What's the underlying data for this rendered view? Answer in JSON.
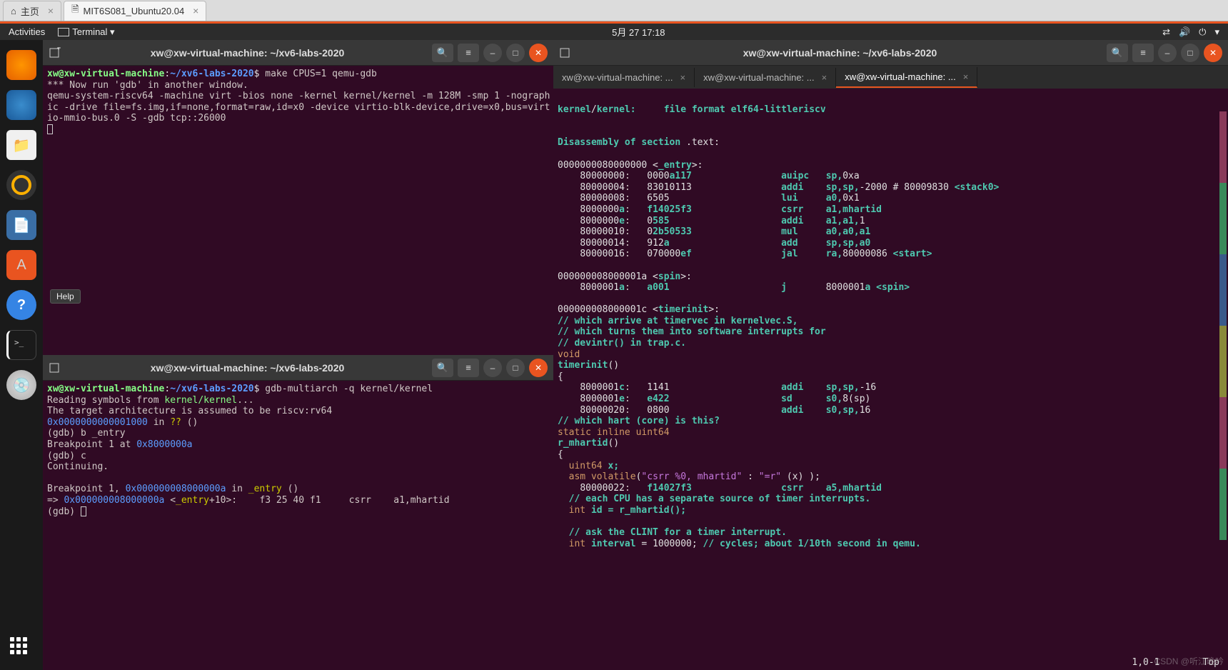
{
  "browserTabs": {
    "home": "主页",
    "vm": "MIT6S081_Ubuntu20.04"
  },
  "topbar": {
    "activities": "Activities",
    "terminal": "Terminal ▾",
    "clock": "5月 27  17:18"
  },
  "tooltip": "Help",
  "term1": {
    "title": "xw@xw-virtual-machine: ~/xv6-labs-2020",
    "prompt_user": "xw@xw-virtual-machine",
    "prompt_path": "~/xv6-labs-2020",
    "cmd": "make CPUS=1 qemu-gdb",
    "l1": "*** Now run 'gdb' in another window.",
    "l2": "qemu-system-riscv64 -machine virt -bios none -kernel kernel/kernel -m 128M -smp 1 -nograph",
    "l3": "ic -drive file=fs.img,if=none,format=raw,id=x0 -device virtio-blk-device,drive=x0,bus=virt",
    "l4": "io-mmio-bus.0 -S -gdb tcp::26000"
  },
  "term2": {
    "title": "xw@xw-virtual-machine: ~/xv6-labs-2020",
    "cmd": "gdb-multiarch -q kernel/kernel",
    "r1_a": "Reading symbols from ",
    "r1_b": "kernel/kernel",
    "r1_c": "...",
    "r2": "The target architecture is assumed to be riscv:rv64",
    "r3_a": "0x0000000000001000",
    "r3_b": " in ",
    "r3_c": "??",
    "r3_d": " ()",
    "r4": "(gdb) b _entry",
    "r5_a": "Breakpoint 1 at ",
    "r5_b": "0x8000000a",
    "r6": "(gdb) c",
    "r7": "Continuing.",
    "r8": "",
    "r9_a": "Breakpoint 1, ",
    "r9_b": "0x000000008000000a",
    "r9_c": " in ",
    "r9_d": "_entry",
    "r9_e": " ()",
    "r10_a": "=> ",
    "r10_b": "0x000000008000000a",
    "r10_c": " <",
    "r10_d": "_entry",
    "r10_e": "+10>:    f3 25 40 f1     csrr    a1,mhartid",
    "r11": "(gdb) "
  },
  "term3": {
    "title": "xw@xw-virtual-machine: ~/xv6-labs-2020",
    "tabs": [
      "xw@xw-virtual-machine: ...",
      "xw@xw-virtual-machine: ...",
      "xw@xw-virtual-machine: ..."
    ],
    "status_pos": "1,0-1",
    "status_right": "Top",
    "h1_a": "kernel",
    "h1_b": "/",
    "h1_c": "kernel:",
    "h1_d": "     file format elf64-littleriscv",
    "h2_a": "Disassembly of section ",
    "h2_b": ".text:",
    "entry_hdr_a": "0000000080000000 <",
    "entry_hdr_b": "_entry",
    "entry_hdr_c": ">:",
    "e": [
      {
        "a": "80000000",
        "b": ":",
        "c": "   0000",
        "d": "a117",
        "sp": "                auipc   ",
        "op": "sp,",
        "ox": "0xa"
      },
      {
        "a": "80000004",
        "b": ":",
        "c": "   83010113",
        "d": "",
        "sp": "                addi    ",
        "op": "sp,sp,",
        "ox": "-2000 # 80009830 ",
        "tl": "<stack0>"
      },
      {
        "a": "80000008",
        "b": ":",
        "c": "   6505",
        "d": "",
        "sp": "                    lui     ",
        "op": "a0,",
        "ox": "0x1"
      },
      {
        "a": "8000000a",
        "b": ":",
        "c": "   f14025f3",
        "d": "",
        "sp": "                csrr    ",
        "op": "a1,mhartid",
        "ox": ""
      },
      {
        "a": "8000000e",
        "b": ":",
        "c": "   0",
        "d": "585",
        "sp": "                    addi    ",
        "op": "a1,a1,",
        "ox": "1"
      },
      {
        "a": "80000010",
        "b": ":",
        "c": "   0",
        "d": "2b50533",
        "sp": "                mul     ",
        "op": "a0,a0,a1",
        "ox": ""
      },
      {
        "a": "80000014",
        "b": ":",
        "c": "   912",
        "d": "a",
        "sp": "                    add     ",
        "op": "sp,sp,a0",
        "ox": ""
      },
      {
        "a": "80000016",
        "b": ":",
        "c": "   070000",
        "d": "ef",
        "sp": "                jal     ",
        "op": "ra,",
        "ox": "80000086 ",
        "tl": "<start>"
      }
    ],
    "spin_hdr_a": "000000008000001a <",
    "spin_hdr_b": "spin",
    "spin_hdr_c": ">:",
    "spin_a": "8000001a",
    "spin_b": ":",
    "spin_c": "   a001",
    "spin_sp": "                    j       ",
    "spin_ox": "8000001a ",
    "spin_tl": "<spin>",
    "ti_hdr_a": "000000008000001c <",
    "ti_hdr_b": "timerinit",
    "ti_hdr_c": ">:",
    "cm1": "// which arrive at timervec in kernelvec.S,",
    "cm2": "// which turns them into software interrupts for",
    "cm3": "// devintr() in trap.c.",
    "void": "void",
    "tinit": "timerinit",
    "paren": "()",
    "brace_o": "{",
    "ti": [
      {
        "a": "8000001c",
        "c": "   1141",
        "m": "addi    ",
        "op": "sp,sp,",
        "ox": "-16"
      },
      {
        "a": "8000001e",
        "c": "   e422",
        "m": "sd      ",
        "op": "s0,",
        "ox": "8(sp)"
      },
      {
        "a": "80000020",
        "c": "   0800",
        "m": "addi    ",
        "op": "s0,sp,",
        "ox": "16"
      }
    ],
    "cm4": "// which hart (core) is this?",
    "siu": "static inline uint64",
    "rmh": "r_mhartid",
    "paren2": "()",
    "brace_o2": "{",
    "u64": "  uint64",
    "xv": " x;",
    "asm_a": "  asm ",
    "asm_b": "volatile",
    "asm_c": "(",
    "asm_d": "\"csrr %0, mhartid\"",
    "asm_e": " : ",
    "asm_f": "\"=r\"",
    "asm_g": " (x) );",
    "a22_a": "80000022",
    "a22_c": "   f14027f3",
    "a22_m": "csrr    ",
    "a22_op": "a5,mhartid",
    "cm5": "  // each CPU has a separate source of timer interrupts.",
    "iid_a": "  int",
    "iid_b": " id = r_mhartid();",
    "cm6": "  // ask the CLINT for a timer interrupt.",
    "iiv_a": "  int",
    "iiv_b": " interval",
    "iiv_c": " = ",
    "iiv_d": "1000000",
    "iiv_e": "; ",
    "iiv_f": "// cycles; about 1/10th second in qemu."
  },
  "watermark": "CSDN @听江晚吟"
}
